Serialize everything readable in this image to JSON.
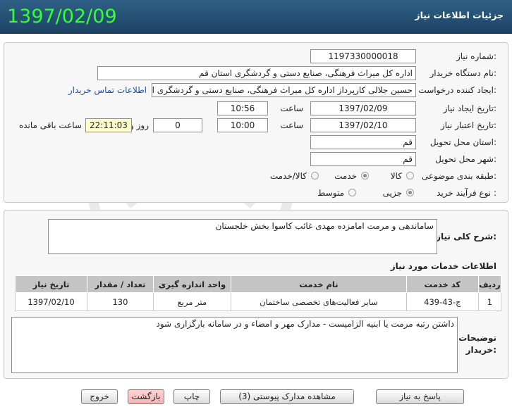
{
  "header": {
    "date": "1397/02/09",
    "title": "جزئیات اطلاعات نیاز"
  },
  "form": {
    "need_number": {
      "label": "شماره نیاز:",
      "value": "1197330000018"
    },
    "buyer_org": {
      "label": "نام دستگاه خریدار:",
      "value": "اداره کل میراث فرهنگی، صنایع دستی و گردشگری استان قم"
    },
    "requester": {
      "label": "ایجاد کننده درخواست:",
      "value": "حسین جلالی کارپرداز اداره کل میراث فرهنگی، صنایع دستی و گردشگری استان",
      "contact_link": "اطلاعات تماس خریدار"
    },
    "announce_date": {
      "label": "تاریخ ایجاد نیاز:",
      "date": "1397/02/09",
      "time_label": "ساعت",
      "time": "10:56"
    },
    "validity_date": {
      "label": "تاریخ اعتبار نیاز:",
      "date": "1397/02/10",
      "time_label": "ساعت",
      "time": "10:00",
      "days": "0",
      "days_label": "روز و",
      "remaining": "22:11:03",
      "remaining_label": "ساعت باقی مانده"
    },
    "province": {
      "label": "استان محل تحویل:",
      "value": "قم"
    },
    "city": {
      "label": "شهر محل تحویل:",
      "value": "قم"
    },
    "category": {
      "label": "طبقه بندی موضوعی:",
      "options": [
        "کالا",
        "خدمت",
        "کالا/خدمت"
      ],
      "selected": "خدمت"
    },
    "process_type": {
      "label": "نوع فرآیند خرید :",
      "options": [
        "جزیی",
        "متوسط"
      ],
      "selected": "جزیی"
    }
  },
  "description": {
    "label": "شرح کلی نیاز:",
    "value": "ساماندهی و مرمت امامزده مهدی غائب کاسوا بخش خلجستان"
  },
  "services": {
    "title": "اطلاعات خدمات مورد نیاز",
    "columns": [
      "ردیف",
      "کد خدمت",
      "نام خدمت",
      "واحد اندازه گیری",
      "تعداد / مقدار",
      "تاریخ نیاز"
    ],
    "rows": [
      [
        "1",
        "ج-43-439",
        "سایر فعالیت‌های تخصصی ساختمان",
        "متر مربع",
        "130",
        "1397/02/10"
      ]
    ]
  },
  "buyer_notes": {
    "label_line1": "توضیحات",
    "label_line2": "خریدار:",
    "value": "داشتن رتبه مرمت یا ابنیه الزامیست - مدارک مهر و امضاء و در سامانه بارگزاری شود"
  },
  "buttons": {
    "reply": "پاسخ به نیاز",
    "attachments": "مشاهده مدارک پیوستی (3)",
    "print": "چاپ",
    "back": "بازگشت",
    "exit": "خروج"
  },
  "colors": {
    "header_bg": "#1d4466",
    "date_green": "#33ff33",
    "back_button": "#f4b4b4",
    "link": "#1a4fb5"
  }
}
